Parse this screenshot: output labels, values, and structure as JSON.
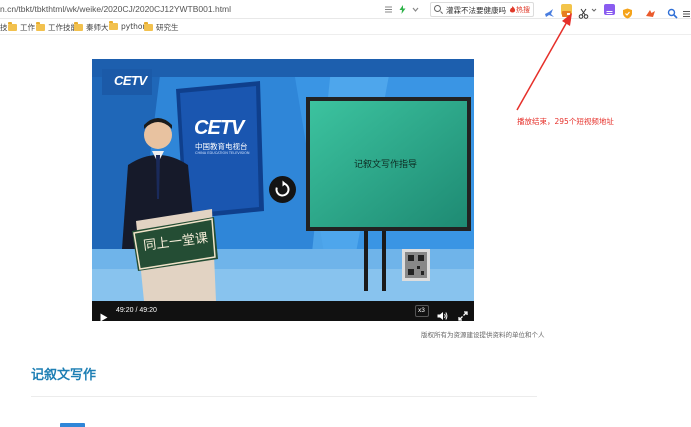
{
  "browser": {
    "url": "n.cn/tbkt/tbkthtml/wk/weike/2020CJ/2020CJ12YWTB001.html",
    "search": {
      "query": "灌霖不法要健康吗",
      "hot_tag": "热搜"
    },
    "bookmarks": [
      {
        "label": "技"
      },
      {
        "label": "工作"
      },
      {
        "label": "工作技能"
      },
      {
        "label": "秦师大"
      },
      {
        "label": "python"
      },
      {
        "label": "研究生"
      }
    ]
  },
  "video": {
    "studio_logo": "CETV",
    "channel_logo": "CETV",
    "channel_name_cn": "中国教育电视台",
    "channel_name_en": "CHINA EDUCATION TELEVISION",
    "podium_text": "同上一堂课",
    "screen_text": "记叙文写作指导",
    "time": "49:20 / 49:20",
    "speed": "x3"
  },
  "page": {
    "disclaimer": "版权所有为资源建设提供资料的单位和个人",
    "section_title": "记叙文写作"
  },
  "annotation": {
    "text": "播放结束，295个短视频地址",
    "color": "#e6302a"
  },
  "colors": {
    "accent": "#1e7fb4",
    "annotation": "#e6302a",
    "folder": "#f2c14e"
  }
}
